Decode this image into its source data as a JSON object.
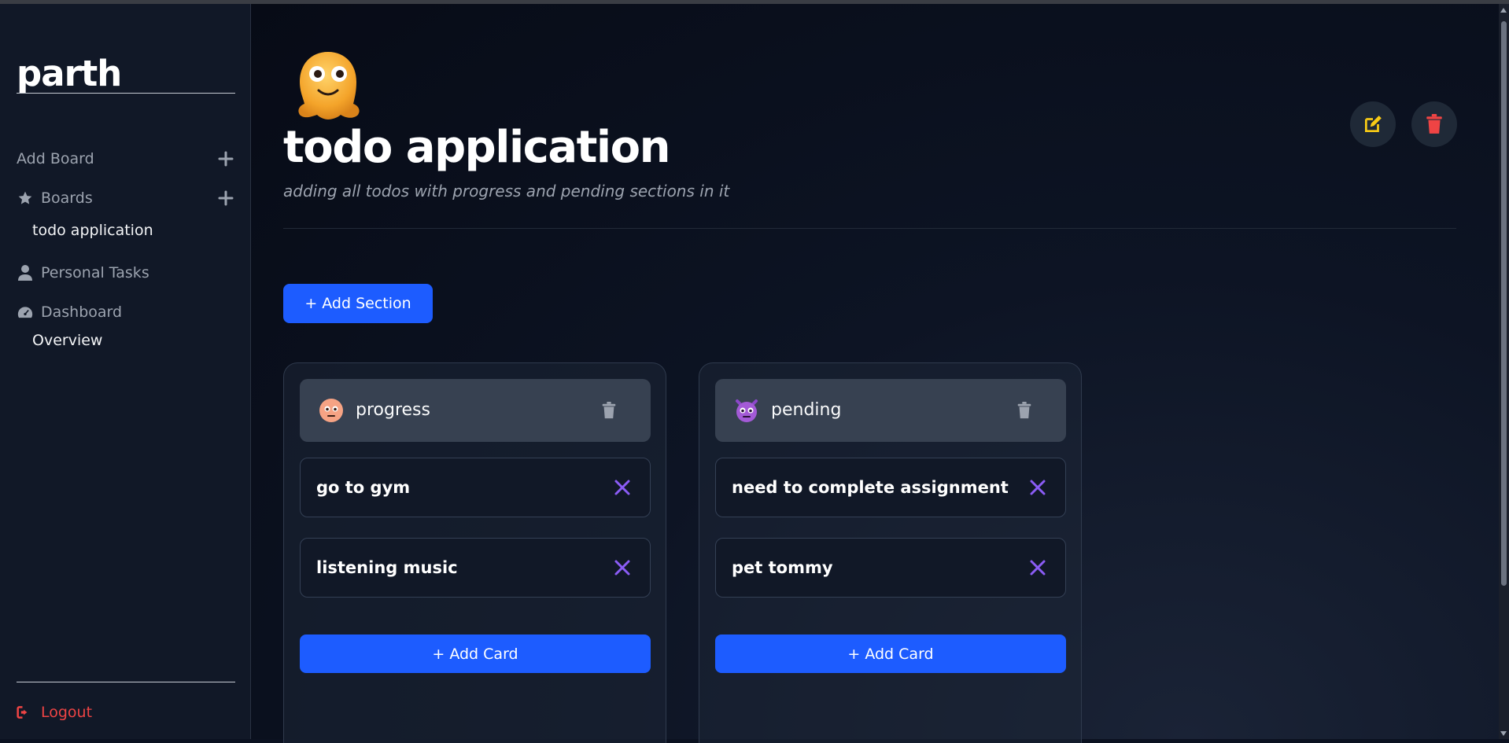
{
  "sidebar": {
    "brand": "parth",
    "add_board": "Add Board",
    "boards": "Boards",
    "board_items": [
      "todo application"
    ],
    "personal_tasks": "Personal Tasks",
    "dashboard": "Dashboard",
    "dashboard_items": [
      "Overview"
    ],
    "logout": "Logout"
  },
  "board": {
    "emoji": "melting-face-emoji",
    "title": "todo application",
    "description": "adding all todos with progress and pending sections in it",
    "add_section_label": "+ Add Section"
  },
  "sections": [
    {
      "title": "progress",
      "emoji": "sad-face-emoji",
      "cards": [
        "go to gym",
        "listening music"
      ],
      "add_card_label": "+ Add Card"
    },
    {
      "title": "pending",
      "emoji": "purple-devil-face-emoji",
      "cards": [
        "need to complete assignment",
        "pet tommy"
      ],
      "add_card_label": "+ Add Card"
    }
  ],
  "colors": {
    "accent": "#1d5cff",
    "edit_icon": "#facc15",
    "delete_icon": "#ef4444",
    "card_close_icon": "#8b5cf6",
    "logout": "#ef4444"
  },
  "icons": [
    "plus-icon",
    "star-icon",
    "user-icon",
    "gauge-icon",
    "sign-out-icon",
    "edit-icon",
    "trash-icon",
    "close-icon"
  ]
}
